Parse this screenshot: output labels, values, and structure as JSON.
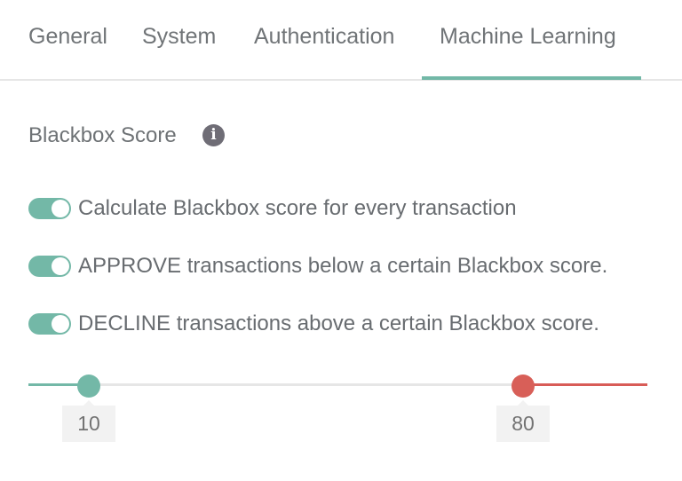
{
  "tabs": [
    {
      "label": "General",
      "active": false
    },
    {
      "label": "System",
      "active": false
    },
    {
      "label": "Authentication",
      "active": false
    },
    {
      "label": "Machine Learning",
      "active": true
    }
  ],
  "colors": {
    "accent": "#73b8a7",
    "danger": "#d85c57",
    "text": "#686c70",
    "track": "#e6e6e6"
  },
  "section": {
    "title": "Blackbox Score",
    "info_icon": "info-icon"
  },
  "settings": [
    {
      "label": "Calculate Blackbox score for every transaction",
      "enabled": true
    },
    {
      "label": "APPROVE transactions below a certain Blackbox score.",
      "enabled": true
    },
    {
      "label": "DECLINE transactions above a certain Blackbox score.",
      "enabled": true
    }
  ],
  "threshold_slider": {
    "min": 0,
    "max": 100,
    "approve_below": "10",
    "decline_above": "80"
  }
}
